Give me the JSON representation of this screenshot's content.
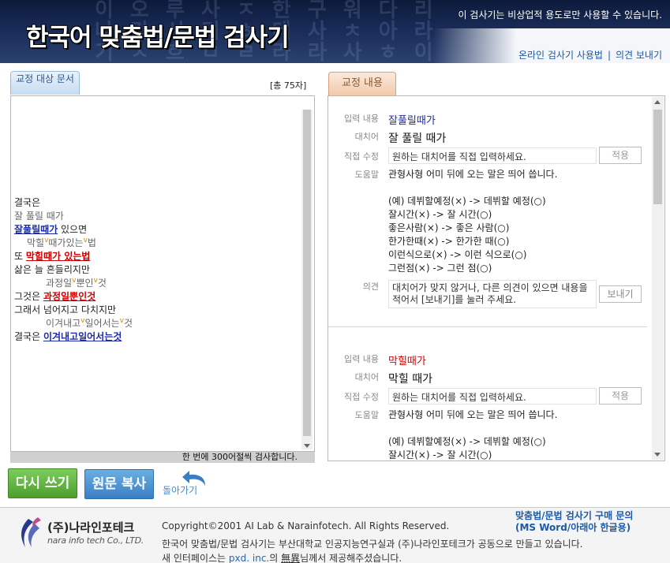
{
  "header": {
    "title": "한국어 맞춤법/문법 검사기",
    "notice": "이 검사기는 비상업적 용도로만 사용할 수 있습니다.",
    "deco_lines": [
      "이 오 루 사 ㅈ 한 구 워 다 리",
      "나 라 시 미 ㅎ 데 사 ㅊ 아 라",
      "기 ㅅ 흐 ㅁ ㄹ 라 라 사 ㅎ 이"
    ],
    "link_manual": "온라인 검사기 사용법",
    "link_separator": "|",
    "link_feedback": "의견 보내기"
  },
  "left": {
    "tab_label": "교정 대상 문서",
    "count": "[총 75자]",
    "footer_note": "한 번에 300어절씩 검사합니다.",
    "lines": [
      {
        "type": "plain",
        "text": "결국은"
      },
      {
        "type": "gray",
        "text": "잘 풀릴 때가"
      },
      {
        "type": "mix",
        "before": "",
        "hl": "잘풀릴때가",
        "color": "blue",
        "after": " 있으면"
      },
      {
        "type": "sub",
        "parts": [
          "막힐",
          "때가있는",
          "법"
        ]
      },
      {
        "type": "mix",
        "before": "또 ",
        "hl": "막힐때가 있는법",
        "color": "red",
        "after": ""
      },
      {
        "type": "plain",
        "text": "삶은 늘 흔들리지만"
      },
      {
        "type": "sub2",
        "parts": [
          "과정일",
          "뿐인",
          "것"
        ]
      },
      {
        "type": "mix",
        "before": "그것은 ",
        "hl": "과정일뿐인것",
        "color": "red",
        "after": ""
      },
      {
        "type": "plain",
        "text": "그래서 넘어지고 다치지만"
      },
      {
        "type": "sub2",
        "parts": [
          "이겨내고",
          "일어서는",
          "것"
        ]
      },
      {
        "type": "mix",
        "before": "결국은 ",
        "hl": "이겨내고일어서는것",
        "color": "blue",
        "after": ""
      }
    ]
  },
  "buttons": {
    "rewrite": "다시 쓰기",
    "copy": "원문 복사",
    "back": "돌아가기"
  },
  "right": {
    "tab_label": "교정 내용",
    "labels": {
      "input": "입력 내용",
      "suggestion": "대치어",
      "manual": "직접 수정",
      "help": "도움말",
      "opinion": "의견"
    },
    "manual_placeholder": "원하는 대치어를 직접 입력하세요.",
    "apply_label": "적용",
    "opinion_placeholder": "대치어가 맞지 않거나, 다른 의견이 있으면 내용을 적어서 [보내기]를 눌러 주세요.",
    "send_label": "보내기",
    "entries": [
      {
        "input": "잘풀릴때가",
        "input_color": "#1a2aa8",
        "suggestion": "잘 풀릴 때가",
        "help_lines": [
          "관형사형 어미 뒤에 오는 말은 띄어 씁니다.",
          "",
          "(예) 데뷔할예정(×) -> 데뷔할 예정(○)",
          "잘시간(×) -> 잘 시간(○)",
          "좋은사람(×) -> 좋은 사람(○)",
          "한가한때(×) -> 한가한 때(○)",
          "이런식으로(×) -> 이런 식으로(○)",
          "그런점(×) -> 그런 점(○)"
        ]
      },
      {
        "input": "막힐때가",
        "input_color": "#cc0000",
        "suggestion": "막힐 때가",
        "help_lines": [
          "관형사형 어미 뒤에 오는 말은 띄어 씁니다.",
          "",
          "(예) 데뷔할예정(×) -> 데뷔할 예정(○)",
          "잘시간(×) -> 잘 시간(○)"
        ]
      }
    ]
  },
  "footer": {
    "company": "(주)나라인포테크",
    "company_en": "nara info tech Co., LTD.",
    "copyright": "Copyright©2001 AI Lab & Narainfotech. All Rights Reserved.",
    "desc1": "한국어 맞춤법/문법 검사기는 부산대학교 인공지능연구실과 (주)나라인포테크가 공동으로 만들고 있습니다.",
    "desc2_prefix": "새 인터페이스는 ",
    "desc2_link": "pxd. inc.",
    "desc2_mid": "의 ",
    "desc2_underlined": "無異",
    "desc2_suffix": "님께서 제공해주셨습니다.",
    "buy_line1": "맞춤법/문법 검사기 구매 문의",
    "buy_line2": "(MS Word/아래아 한글용)"
  }
}
